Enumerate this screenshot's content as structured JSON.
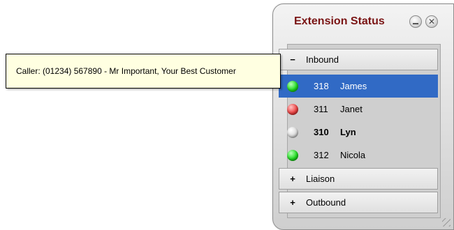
{
  "tooltip": {
    "text": "Caller: (01234) 567890 - Mr Important, Your Best Customer"
  },
  "window": {
    "title": "Extension Status",
    "minimize_icon": "minimize-icon",
    "close_icon": "close-icon"
  },
  "groups": {
    "inbound": {
      "sign": "−",
      "label": "Inbound"
    },
    "liaison": {
      "sign": "+",
      "label": "Liaison"
    },
    "outbound": {
      "sign": "+",
      "label": "Outbound"
    }
  },
  "extensions": [
    {
      "ext": "318",
      "name": "James",
      "status_color": "#22dd22",
      "selected": true
    },
    {
      "ext": "311",
      "name": "Janet",
      "status_color": "#ee4444",
      "selected": false
    },
    {
      "ext": "310",
      "name": "Lyn",
      "status_color": "#dcdcdc",
      "selected": false
    },
    {
      "ext": "312",
      "name": "Nicola",
      "status_color": "#22dd22",
      "selected": false
    }
  ],
  "colors": {
    "title": "#7a1414",
    "selection": "#316ac5",
    "tooltip_bg": "#ffffe1"
  }
}
